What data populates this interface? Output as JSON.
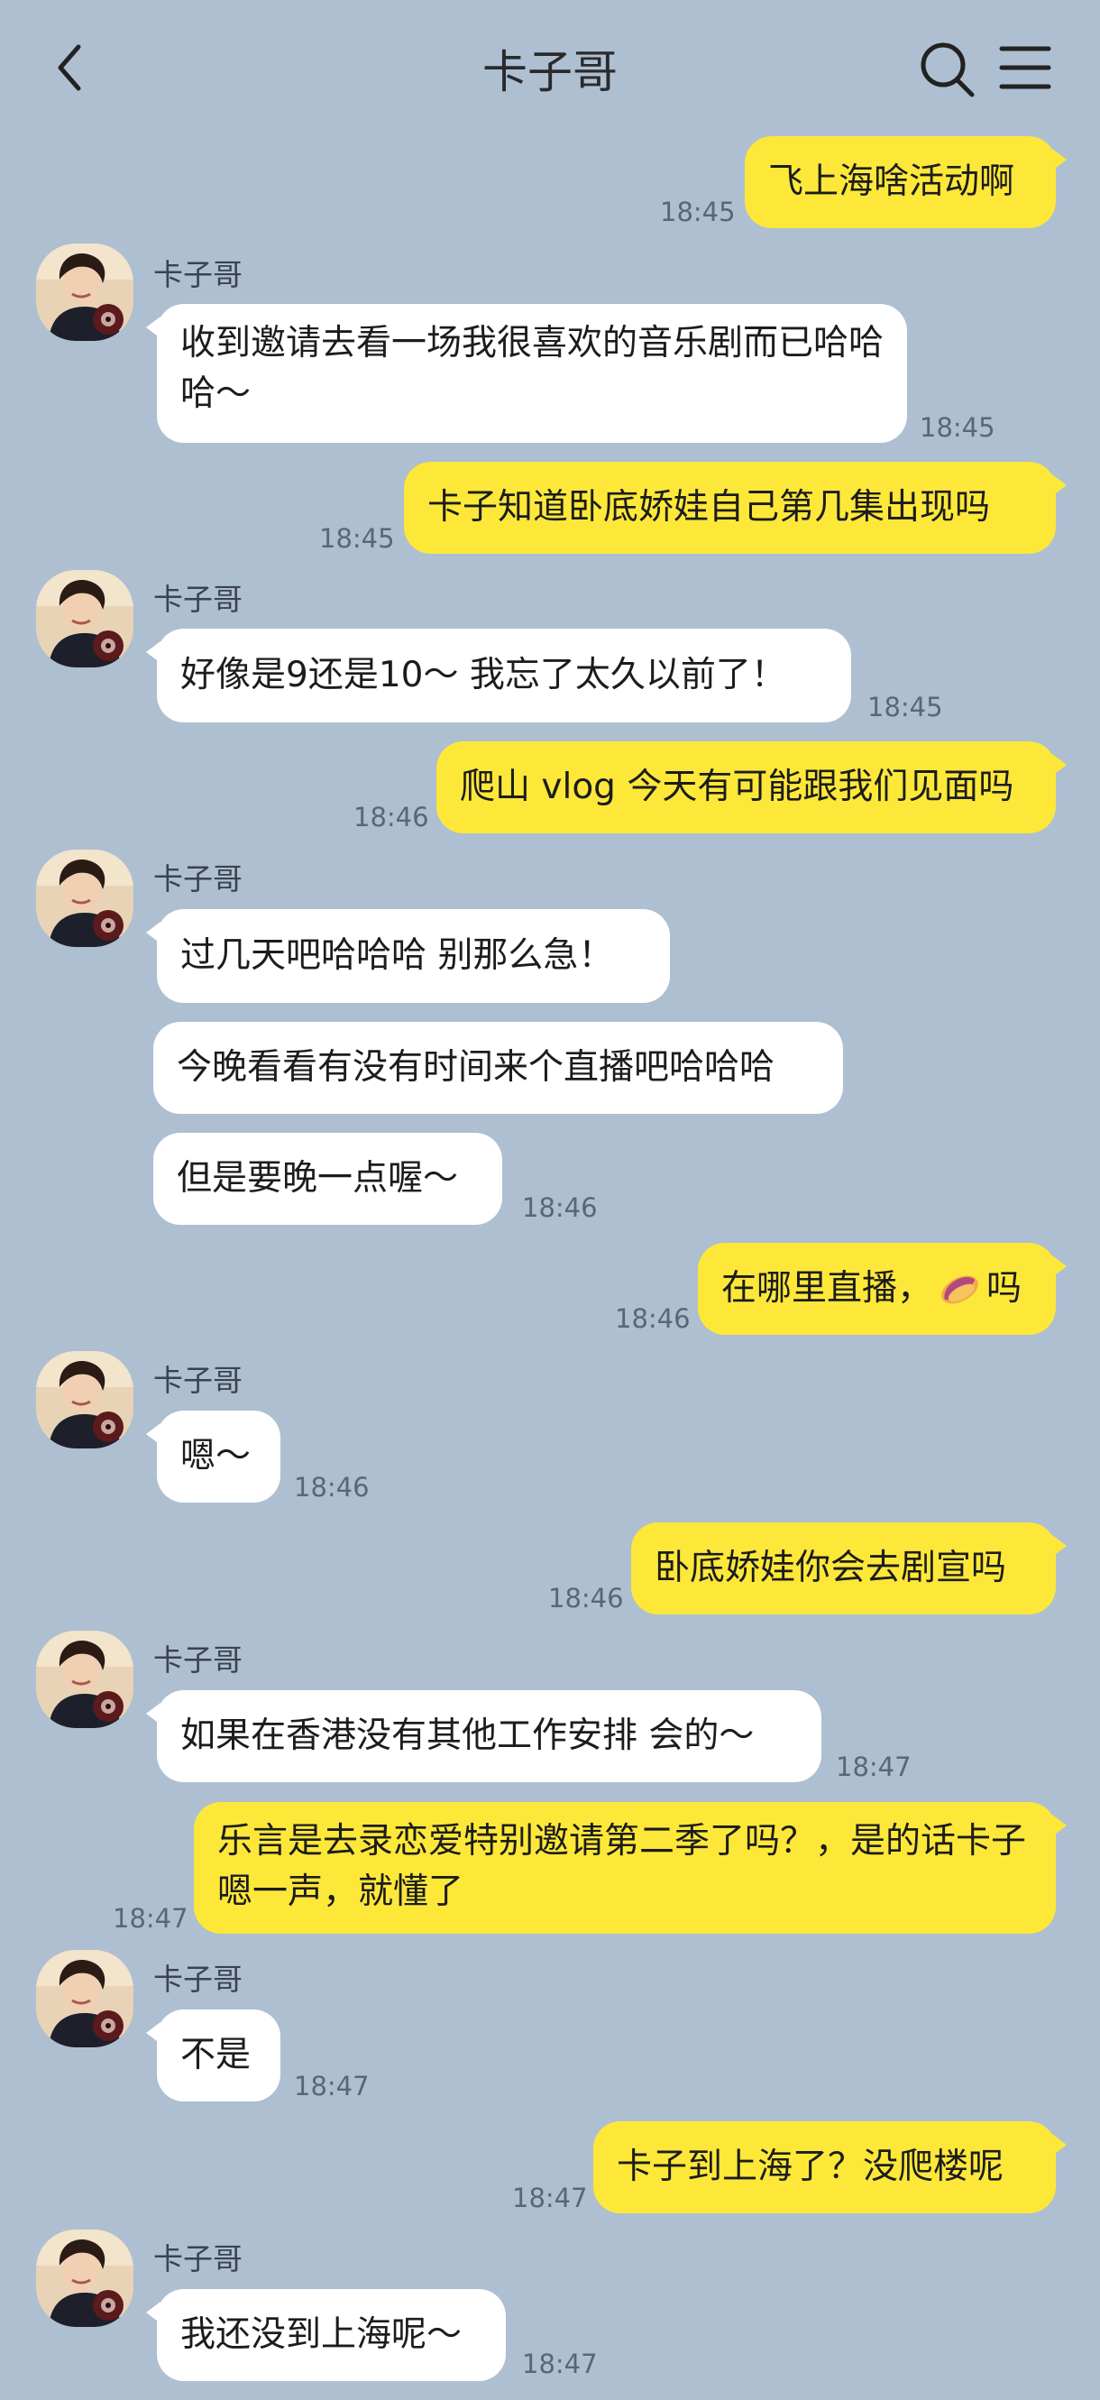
{
  "header": {
    "title": "卡子哥"
  },
  "contact": {
    "name": "卡子哥"
  },
  "messages": [
    {
      "text": "飞上海啥活动啊",
      "time": "18:45"
    },
    {
      "text": "收到邀请去看一场我很喜欢的音乐剧而已哈哈哈～",
      "time": "18:45"
    },
    {
      "text": "卡子知道卧底娇娃自己第几集出现吗",
      "time": "18:45"
    },
    {
      "text": "好像是9还是10～ 我忘了太久以前了！",
      "time": "18:45"
    },
    {
      "text": "爬山 vlog 今天有可能跟我们见面吗",
      "time": "18:46"
    },
    {
      "text": "过几天吧哈哈哈 别那么急！",
      "time": ""
    },
    {
      "text": "今晚看看有没有时间来个直播吧哈哈哈",
      "time": ""
    },
    {
      "text": "但是要晚一点喔～",
      "time": "18:46"
    },
    {
      "text_before": "在哪里直播，",
      "emoji": "sweet-potato-emoji",
      "text_after": "吗",
      "time": "18:46"
    },
    {
      "text": "嗯～",
      "time": "18:46"
    },
    {
      "text": "卧底娇娃你会去剧宣吗",
      "time": "18:46"
    },
    {
      "text": "如果在香港没有其他工作安排 会的～",
      "time": "18:47"
    },
    {
      "text": "乐言是去录恋爱特别邀请第二季了吗？，是的话卡子嗯一声，就懂了",
      "time": "18:47"
    },
    {
      "text": "不是",
      "time": "18:47"
    },
    {
      "text": "卡子到上海了？没爬楼呢",
      "time": "18:47"
    },
    {
      "text": "我还没到上海呢～",
      "time": "18:47"
    }
  ],
  "icons": {
    "back": "chevron-left-icon",
    "search": "search-icon",
    "menu": "menu-icon",
    "avatar": "avatar"
  },
  "colors": {
    "background": "#aebfd1",
    "incoming_bubble": "#ffffff",
    "outgoing_bubble": "#fde83a",
    "timestamp": "#5b6674"
  }
}
